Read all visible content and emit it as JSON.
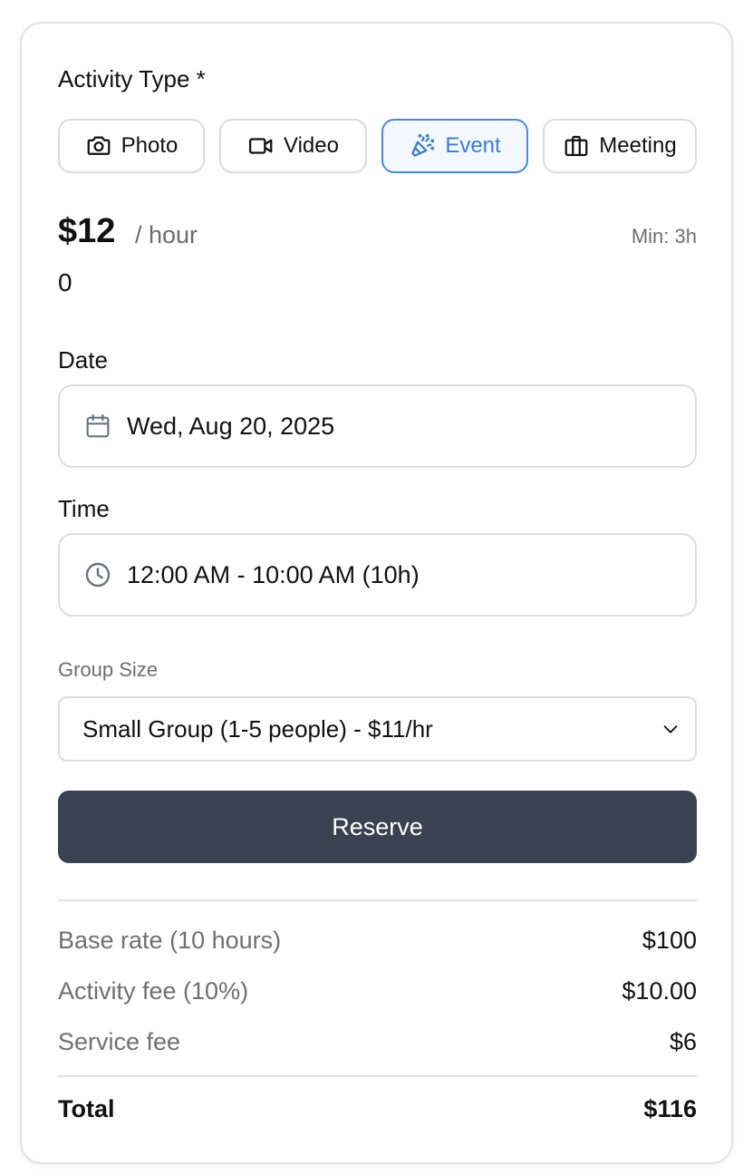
{
  "activity": {
    "label": "Activity Type *",
    "types": [
      {
        "label": "Photo",
        "icon": "camera-icon"
      },
      {
        "label": "Video",
        "icon": "video-camera-icon"
      },
      {
        "label": "Event",
        "icon": "party-popper-icon",
        "selected": true
      },
      {
        "label": "Meeting",
        "icon": "briefcase-icon"
      }
    ]
  },
  "pricing": {
    "price": "$12",
    "unit": "/ hour",
    "min": "Min: 3h",
    "extra_value": "0"
  },
  "date": {
    "label": "Date",
    "value": "Wed, Aug 20, 2025",
    "icon": "calendar-icon"
  },
  "time": {
    "label": "Time",
    "value": "12:00 AM - 10:00 AM (10h)",
    "icon": "clock-icon"
  },
  "group": {
    "label": "Group Size",
    "selected": "Small Group (1-5 people) - $11/hr",
    "icon": "chevron-down-icon"
  },
  "reserve_label": "Reserve",
  "breakdown": {
    "base_rate_label": "Base rate (10 hours)",
    "base_rate_value": "$100",
    "activity_fee_label": "Activity fee (10%)",
    "activity_fee_value": "$10.00",
    "service_fee_label": "Service fee",
    "service_fee_value": "$6",
    "total_label": "Total",
    "total_value": "$116"
  },
  "colors": {
    "accent": "#4a86e8",
    "button_dark": "#3a4150"
  }
}
